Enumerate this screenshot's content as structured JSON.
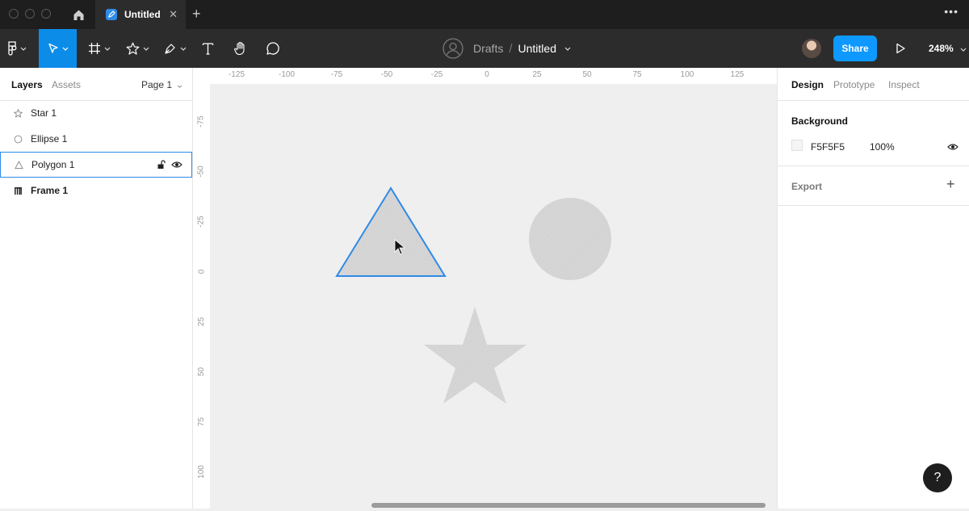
{
  "titlebar": {
    "tab_title": "Untitled",
    "tab_close": "✕",
    "new_tab": "+",
    "more": "•••"
  },
  "toolbar": {
    "drafts": "Drafts",
    "separator": "/",
    "file_name": "Untitled",
    "share": "Share",
    "zoom": "248%"
  },
  "left_panel": {
    "tabs": {
      "layers": "Layers",
      "assets": "Assets"
    },
    "page": "Page 1",
    "layers": [
      {
        "name": "Star 1",
        "icon": "star-icon"
      },
      {
        "name": "Ellipse 1",
        "icon": "ellipse-icon"
      },
      {
        "name": "Polygon 1",
        "icon": "triangle-icon",
        "selected": true
      },
      {
        "name": "Frame 1",
        "icon": "frame-icon"
      }
    ]
  },
  "rulers": {
    "horizontal": [
      "-125",
      "-100",
      "-75",
      "-50",
      "-25",
      "0",
      "25",
      "50",
      "75",
      "100",
      "125"
    ],
    "vertical": [
      "-75",
      "-50",
      "-25",
      "0",
      "25",
      "50",
      "75",
      "100"
    ]
  },
  "right_panel": {
    "tabs": {
      "design": "Design",
      "prototype": "Prototype",
      "inspect": "Inspect"
    },
    "background": {
      "title": "Background",
      "hex": "F5F5F5",
      "opacity": "100%",
      "swatch_color": "#f5f5f5"
    },
    "export": {
      "title": "Export",
      "add": "+"
    }
  },
  "help": "?",
  "colors": {
    "accent": "#0c8ce9",
    "share": "#0d99ff",
    "selection": "#2f8be8",
    "shape_fill": "#d9d9d9"
  }
}
